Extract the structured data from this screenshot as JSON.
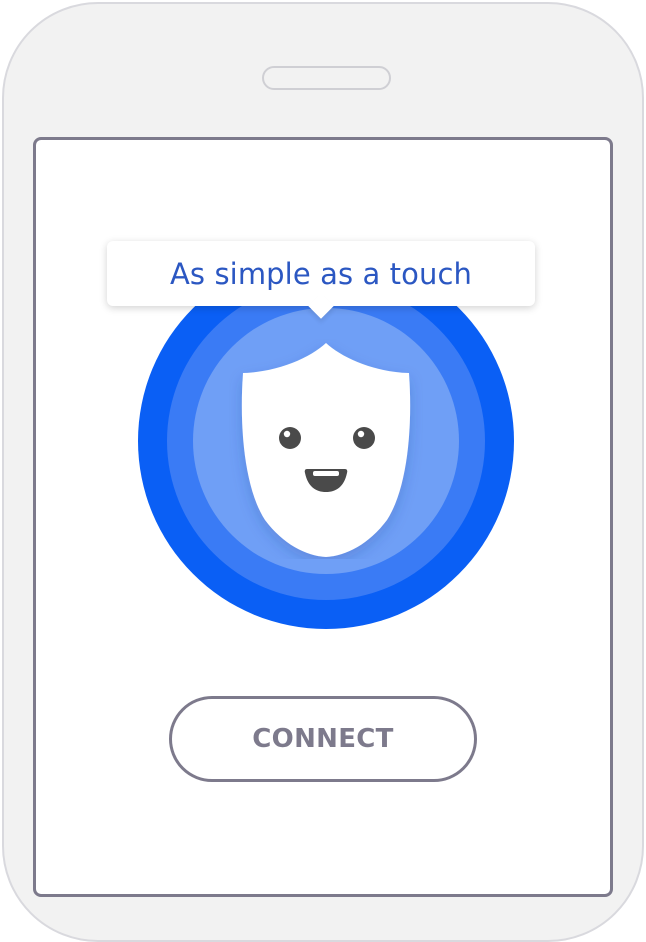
{
  "tooltip": {
    "text": "As simple as a touch"
  },
  "connect": {
    "label": "CONNECT"
  },
  "icons": {
    "mascot": "shield-face-icon",
    "speaker": "phone-speaker-icon"
  },
  "colors": {
    "outer_ring": "#0a5ff5",
    "middle_ring": "#3a7bf5",
    "inner_ring": "#6f9ff6",
    "tooltip_text": "#2b57c2",
    "connect_text": "#7d7a8c",
    "frame": "#f2f2f2",
    "screen_border": "#7d7a8c"
  }
}
